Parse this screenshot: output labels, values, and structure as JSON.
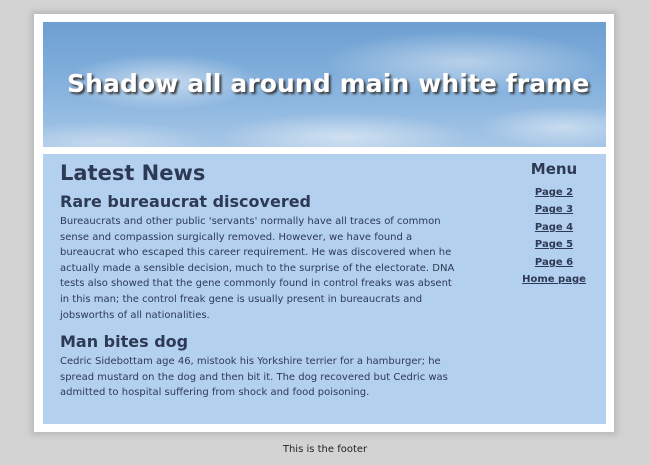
{
  "header": {
    "title": "Shadow all around main white frame"
  },
  "main": {
    "heading": "Latest News",
    "articles": [
      {
        "title": "Rare bureaucrat discovered",
        "body": "Bureaucrats and other public 'servants' normally have all traces of common sense and compassion surgically removed. However, we have found a bureaucrat who escaped this career requirement. He was discovered when he actually made a sensible decision, much to the surprise of the electorate. DNA tests also showed that the gene commonly found in control freaks was absent in this man; the control freak gene is usually present in bureaucrats and jobsworths of all nationalities."
      },
      {
        "title": "Man bites dog",
        "body": "Cedric Sidebottam age 46, mistook his Yorkshire terrier for a hamburger; he spread mustard on the dog and then bit it.  The dog recovered but Cedric was admitted to hospital suffering from shock and food poisoning."
      }
    ]
  },
  "menu": {
    "title": "Menu",
    "items": [
      "Page 2",
      "Page 3",
      "Page 4",
      "Page 5",
      "Page 6",
      "Home page"
    ]
  },
  "footer": {
    "text": "This is the footer"
  },
  "colors": {
    "page_background": "#d3d3d3",
    "frame": "#ffffff",
    "content_background": "#b3d0ee",
    "text": "#2e3a55",
    "header_sky": "#7aa9d8"
  }
}
